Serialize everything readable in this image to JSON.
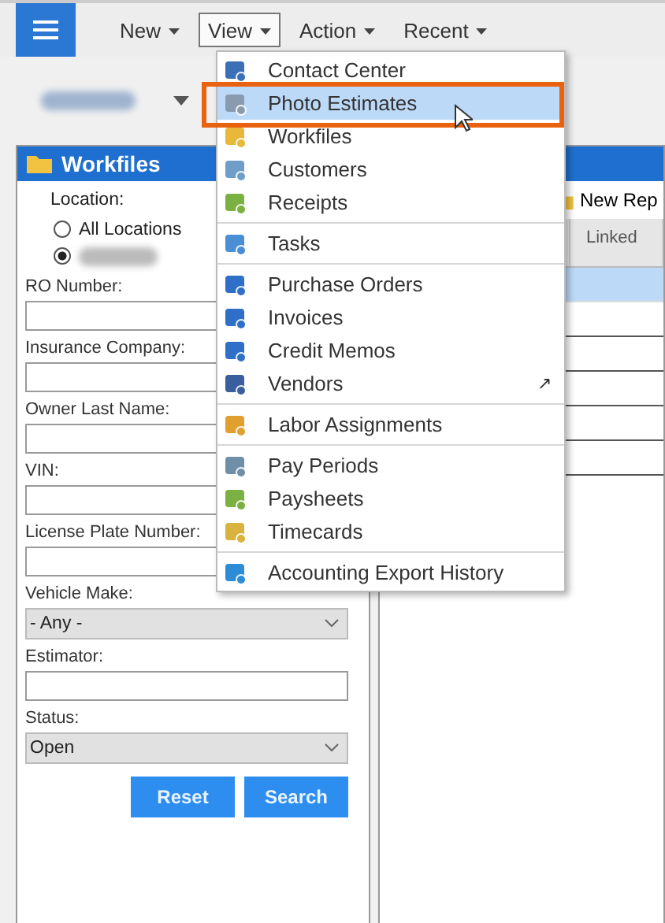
{
  "menubar": [
    {
      "label": "New",
      "selected": false
    },
    {
      "label": "View",
      "selected": true
    },
    {
      "label": "Action",
      "selected": false
    },
    {
      "label": "Recent",
      "selected": false
    }
  ],
  "workfiles_panel": {
    "title": "Workfiles",
    "location": {
      "label": "Location:",
      "options": [
        {
          "label": "All Locations",
          "selected": false
        },
        {
          "selected": true
        }
      ]
    },
    "fields": [
      {
        "kind": "text",
        "label": "RO Number:"
      },
      {
        "kind": "text",
        "label": "Insurance Company:"
      },
      {
        "kind": "text",
        "label": "Owner Last Name:"
      },
      {
        "kind": "text",
        "label": "VIN:"
      },
      {
        "kind": "text",
        "label": "License Plate Number:"
      },
      {
        "kind": "select",
        "label": "Vehicle Make:",
        "value": "- Any -"
      },
      {
        "kind": "text",
        "label": "Estimator:"
      },
      {
        "kind": "select",
        "label": "Status:",
        "value": "Open"
      }
    ],
    "buttons": [
      "Reset",
      "Search"
    ]
  },
  "list_panel": {
    "toolbar_button": "New Rep",
    "columns": [
      "Linked"
    ],
    "rows": [
      {
        "selected": true
      },
      {
        "selected": false
      },
      {
        "selected": false
      },
      {
        "selected": false
      },
      {
        "selected": false
      },
      {
        "selected": false
      }
    ]
  },
  "view_menu": {
    "groups": [
      [
        {
          "label": "Contact Center",
          "selected": false
        },
        {
          "label": "Photo Estimates",
          "selected": true
        },
        {
          "label": "Workfiles",
          "selected": false
        },
        {
          "label": "Customers",
          "selected": false
        },
        {
          "label": "Receipts",
          "selected": false
        }
      ],
      [
        {
          "label": "Tasks",
          "selected": false
        }
      ],
      [
        {
          "label": "Purchase Orders",
          "selected": false
        },
        {
          "label": "Invoices",
          "selected": false
        },
        {
          "label": "Credit Memos",
          "selected": false
        },
        {
          "label": "Vendors",
          "selected": false,
          "trailing": "↗"
        }
      ],
      [
        {
          "label": "Labor Assignments",
          "selected": false
        }
      ],
      [
        {
          "label": "Pay Periods",
          "selected": false
        },
        {
          "label": "Paysheets",
          "selected": false
        },
        {
          "label": "Timecards",
          "selected": false
        }
      ],
      [
        {
          "label": "Accounting Export History",
          "selected": false
        }
      ]
    ]
  }
}
